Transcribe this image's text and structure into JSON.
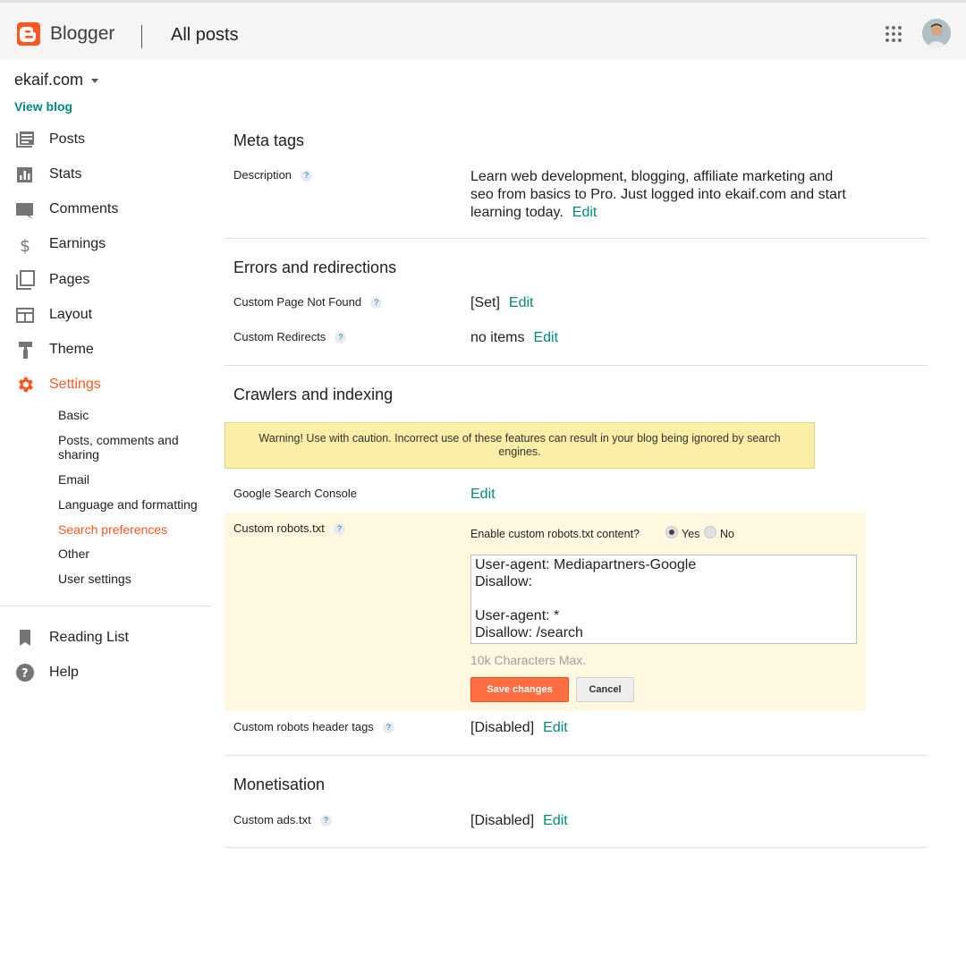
{
  "header": {
    "brand": "Blogger",
    "title": "All posts",
    "accent_color": "#ff5722"
  },
  "sidebar": {
    "blog_name": "ekaif.com",
    "view_blog": "View blog",
    "items": [
      {
        "label": "Posts",
        "icon": "posts-icon"
      },
      {
        "label": "Stats",
        "icon": "stats-icon"
      },
      {
        "label": "Comments",
        "icon": "comments-icon"
      },
      {
        "label": "Earnings",
        "icon": "dollar-icon"
      },
      {
        "label": "Pages",
        "icon": "pages-icon"
      },
      {
        "label": "Layout",
        "icon": "layout-icon"
      },
      {
        "label": "Theme",
        "icon": "paint-roller-icon"
      },
      {
        "label": "Settings",
        "icon": "gear-icon",
        "active": true
      }
    ],
    "settings_sub": [
      {
        "label": "Basic"
      },
      {
        "label": "Posts, comments and sharing"
      },
      {
        "label": "Email"
      },
      {
        "label": "Language and formatting"
      },
      {
        "label": "Search preferences",
        "active": true
      },
      {
        "label": "Other"
      },
      {
        "label": "User settings"
      }
    ],
    "bottom_items": [
      {
        "label": "Reading List",
        "icon": "bookmark-icon"
      },
      {
        "label": "Help",
        "icon": "help-icon"
      }
    ]
  },
  "main": {
    "meta_tags": {
      "title": "Meta tags",
      "description_label": "Description",
      "description_value": "Learn web development, blogging, affiliate marketing and seo from basics to Pro. Just logged into ekaif.com and start learning today.",
      "edit": "Edit"
    },
    "errors": {
      "title": "Errors and redirections",
      "not_found_label": "Custom Page Not Found",
      "not_found_value": "[Set]",
      "redirects_label": "Custom Redirects",
      "redirects_value": "no items",
      "edit": "Edit"
    },
    "crawlers": {
      "title": "Crawlers and indexing",
      "warning": "Warning! Use with caution. Incorrect use of these features can result in your blog being ignored by search engines.",
      "gsc_label": "Google Search Console",
      "edit": "Edit",
      "robots_label": "Custom robots.txt",
      "enable_question": "Enable custom robots.txt content?",
      "yes": "Yes",
      "no": "No",
      "robots_content": "User-agent: Mediapartners-Google\nDisallow:\n\nUser-agent: *\nDisallow: /search",
      "char_max": "10k Characters Max.",
      "save": "Save changes",
      "cancel": "Cancel",
      "header_tags_label": "Custom robots header tags",
      "header_tags_value": "[Disabled]"
    },
    "monetisation": {
      "title": "Monetisation",
      "ads_label": "Custom ads.txt",
      "ads_value": "[Disabled]",
      "edit": "Edit"
    },
    "help_mark": "?"
  }
}
